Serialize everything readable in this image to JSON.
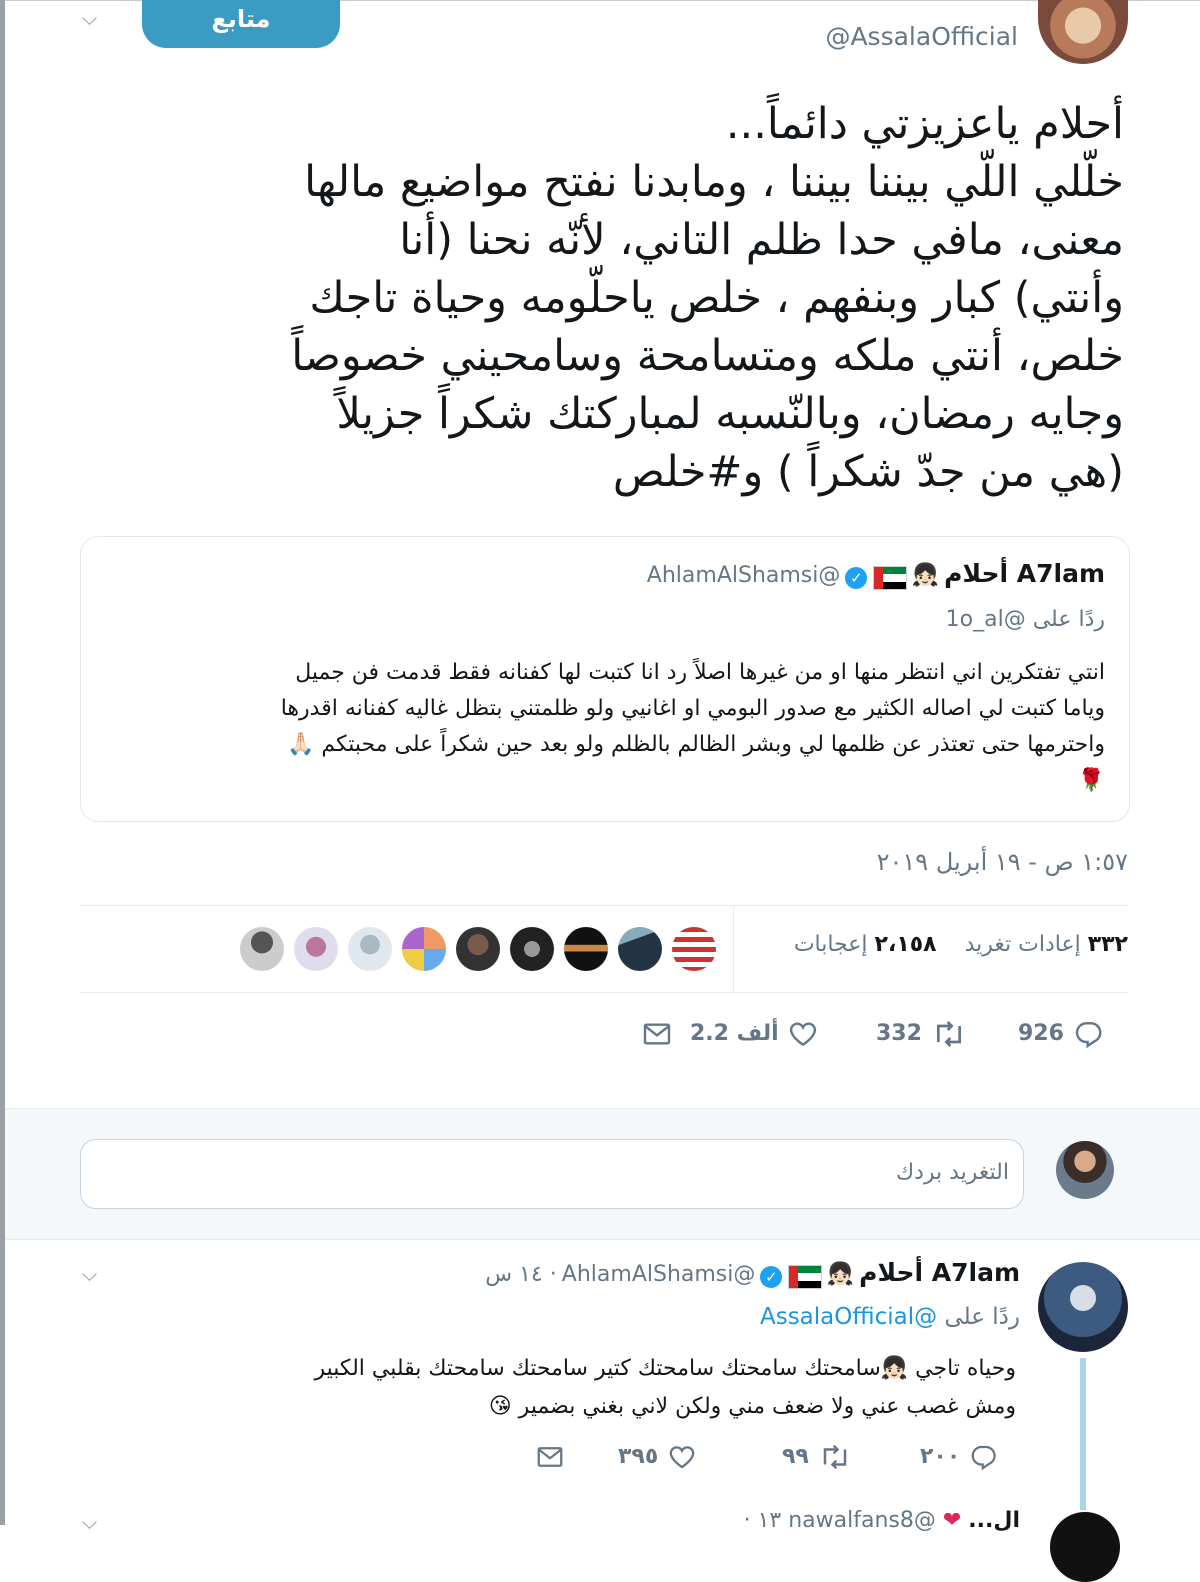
{
  "tweet": {
    "handle": "@AssalaOfficial",
    "follow_label": "متابع",
    "text": "أحلام ياعزيزتي دائماً...\nخلّلي اللّي بيننا بيننا ، ومابدنا نفتح مواضيع مالها\nمعنى، مافي حدا ظلم التاني، لأنّه نحنا (أنا\nوأنتي) كبار وبنفهم ، خلص ياحلّومه وحياة تاجك\nخلص، أنتي ملكه ومتسامحة وسامحيني خصوصاً\nوجايه رمضان، وبالنّسبه لمباركتك شكراً جزيلاً\n(هي من جدّ شكراً ) و#خلص",
    "timestamp": "١:٥٧ ص - ١٩ أبريل ٢٠١٩",
    "stats": {
      "retweets_value": "٣٣٢",
      "retweets_label": "إعادات تغريد",
      "likes_value": "٢،١٥٨",
      "likes_label": "إعجابات"
    },
    "actions": {
      "replies": "926",
      "retweets": "332",
      "likes": "2.2 ألف"
    }
  },
  "quoted": {
    "name": "A7lam أحلام",
    "handle": "@AhlamAlShamsi",
    "reply_to_label": "ردًا على",
    "reply_to_handle": "@1o_al",
    "text": "انتي تفتكرين اني انتظر منها او من غيرها اصلاً رد انا كتبت لها كفنانه فقط قدمت فن جميل\nوياما كتبت لي اصاله الكثير مع صدور البومي او اغانيي ولو ظلمتني بتظل غاليه كفنانه اقدرها\nواحترمها حتى تعتذر عن ظلمها لي وبشر الظالم بالظلم ولو بعد حين شكراً على محبتكم 🙏🏻\n🌹"
  },
  "compose": {
    "placeholder": "التغريد بردك"
  },
  "reply": {
    "name": "A7lam أحلام",
    "handle": "@AhlamAlShamsi",
    "time": "١٤ س",
    "reply_to_label": "ردًا على",
    "reply_to_handle": "@AssalaOfficial",
    "text": "وحياه تاجي 👧🏻سامحتك سامحتك سامحتك كتير  سامحتك سامحتك بقلبي الكبير\nومش غصب عني ولا ضعف مني ولكن لاني بغني بضمير 😘",
    "actions": {
      "replies": "٢٠٠",
      "retweets": "٩٩",
      "likes": "٣٩٥"
    }
  },
  "next": {
    "handle_partial": "@nawalfans8",
    "time_partial": "١٣ ·",
    "name_partial": "ال..."
  },
  "colors": {
    "follow": "#3a9bc3",
    "verified": "#1da1f2",
    "link": "#1b95e0",
    "muted": "#657786"
  }
}
